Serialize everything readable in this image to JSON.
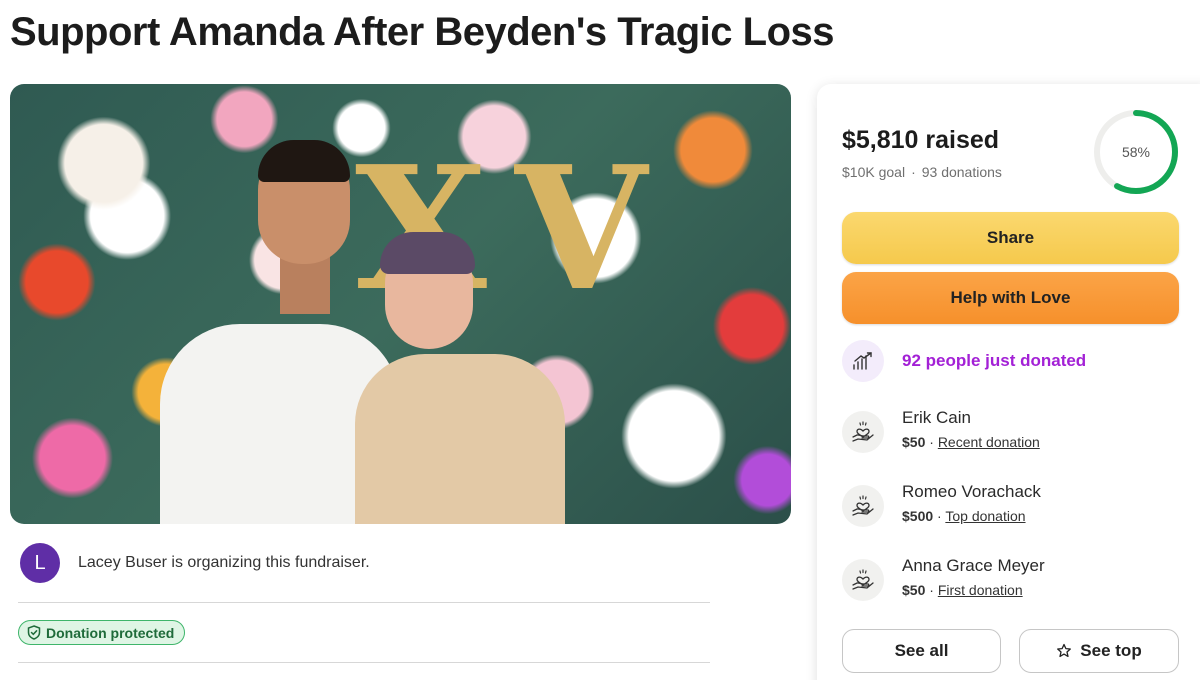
{
  "page": {
    "title": "Support Amanda After Beyden's Tragic Loss"
  },
  "hero": {
    "icon": "photo-couple",
    "letters": [
      "X",
      "V"
    ]
  },
  "organizer": {
    "avatar_initial": "L",
    "text": "Lacey Buser is organizing this fundraiser.",
    "avatar_color": "#5f2ea6"
  },
  "badge": {
    "label": "Donation protected",
    "icon": "shield-check-icon"
  },
  "stats": {
    "raised": "$5,810 raised",
    "goal": "$10K goal",
    "separator": "·",
    "donations": "93 donations",
    "percent_label": "58%",
    "percent": 58,
    "progress_color": "#13a654"
  },
  "actions": {
    "share_label": "Share",
    "help_label": "Help with Love",
    "see_all_label": "See all",
    "see_top_label": "See top"
  },
  "activity": {
    "just_donated": "92 people just donated",
    "accent_color": "#a321d6"
  },
  "donors": [
    {
      "name": "Erik Cain",
      "amount": "$50",
      "separator": "·",
      "tag": "Recent donation"
    },
    {
      "name": "Romeo Vorachack",
      "amount": "$500",
      "separator": "·",
      "tag": "Top donation"
    },
    {
      "name": "Anna Grace Meyer",
      "amount": "$50",
      "separator": "·",
      "tag": "First donation"
    }
  ]
}
